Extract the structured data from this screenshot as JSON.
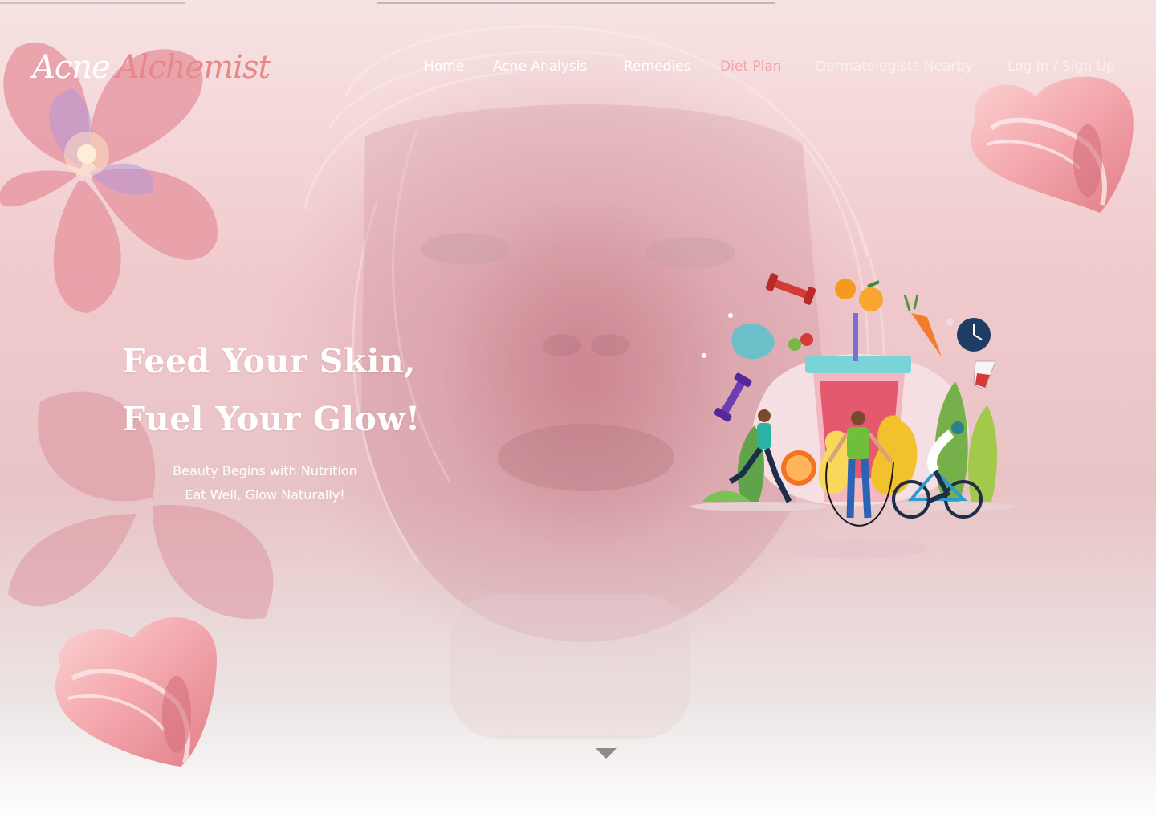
{
  "logo": {
    "word1": "Acne",
    "word2": "Alchemist"
  },
  "nav": {
    "items": [
      {
        "label": "Home"
      },
      {
        "label": "Acne Analysis"
      },
      {
        "label": "Remedies"
      },
      {
        "label": "Diet Plan"
      },
      {
        "label": "Dermatologists Nearby"
      },
      {
        "label": "Log In / Sign Up"
      }
    ],
    "active": "Diet Plan"
  },
  "hero": {
    "headline_line1": "Feed Your Skin,",
    "headline_line2": "Fuel Your Glow!",
    "subline1": "Beauty Begins with Nutrition",
    "subline2": "Eat Well, Glow Naturally!"
  },
  "colors": {
    "accent": "#f2a2a4",
    "logo_accent": "#e88888",
    "text_light": "#ffffff"
  },
  "icons": {
    "scroll": "chevron-down-icon"
  }
}
